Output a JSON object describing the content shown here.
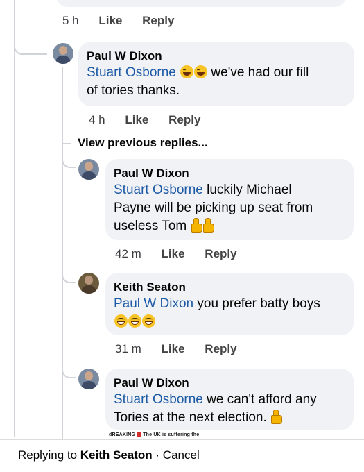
{
  "top_meta": {
    "time": "5 h",
    "like": "Like",
    "reply": "Reply"
  },
  "view_previous": "View previous replies...",
  "comments": [
    {
      "author": "Paul W Dixon",
      "mention": "Stuart Osborne",
      "text_after_emoji": " we've had our fill",
      "text_line2": "of tories thanks.",
      "emojis": [
        "laugh-icon",
        "laugh-icon"
      ],
      "time": "4 h",
      "like": "Like",
      "reply": "Reply"
    },
    {
      "author": "Paul W Dixon",
      "mention": "Stuart Osborne",
      "text": " luckily Michael",
      "text_line2": "Payne will be picking up seat from",
      "text_line3": "useless Tom ",
      "emojis": [
        "thumbs-up-icon",
        "thumbs-up-icon"
      ],
      "time": "42 m",
      "like": "Like",
      "reply": "Reply"
    },
    {
      "author": "Keith Seaton",
      "mention": "Paul W Dixon",
      "text": " you prefer batty boys",
      "emojis": [
        "grin-icon",
        "grin-icon",
        "grin-icon"
      ],
      "time": "31 m",
      "like": "Like",
      "reply": "Reply"
    },
    {
      "author": "Paul W Dixon",
      "mention": "Stuart Osborne",
      "text": " we can't afford any",
      "text_line2": "Tories at the next election. ",
      "emojis": [
        "thumbs-up-icon"
      ]
    }
  ],
  "ticker": {
    "left": "dREAKING",
    "right": "The UK is suffering the"
  },
  "reply_bar": {
    "prefix": "Replying to ",
    "name": "Keith Seaton",
    "sep": " · ",
    "cancel": "Cancel"
  }
}
